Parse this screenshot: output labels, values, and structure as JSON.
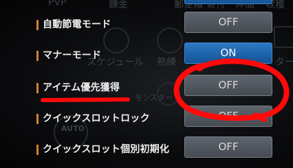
{
  "background": {
    "tabs": [
      "PVP",
      "錬金",
      "郵便箱",
      "寄付",
      "仲間",
      "収穫"
    ],
    "labels": [
      "スケジュール",
      "熟練",
      "ター",
      "モンスター"
    ],
    "auto_badge": "AUTO"
  },
  "settings": [
    {
      "label": "自動節電モード",
      "toggle": "OFF",
      "state": "off"
    },
    {
      "label": "マナーモード",
      "toggle": "ON",
      "state": "on"
    },
    {
      "label": "アイテム優先獲得",
      "toggle": "OFF",
      "state": "off"
    },
    {
      "label": "クイックスロットロック",
      "toggle": "OFF",
      "state": "off"
    },
    {
      "label": "クイックスロット個別初期化",
      "toggle": "OFF",
      "state": "off"
    }
  ],
  "colors": {
    "accent_bar": "#d6802f",
    "toggle_off": "#5e646d",
    "toggle_on": "#1b64ad",
    "annotation": "#ff0a0a"
  }
}
